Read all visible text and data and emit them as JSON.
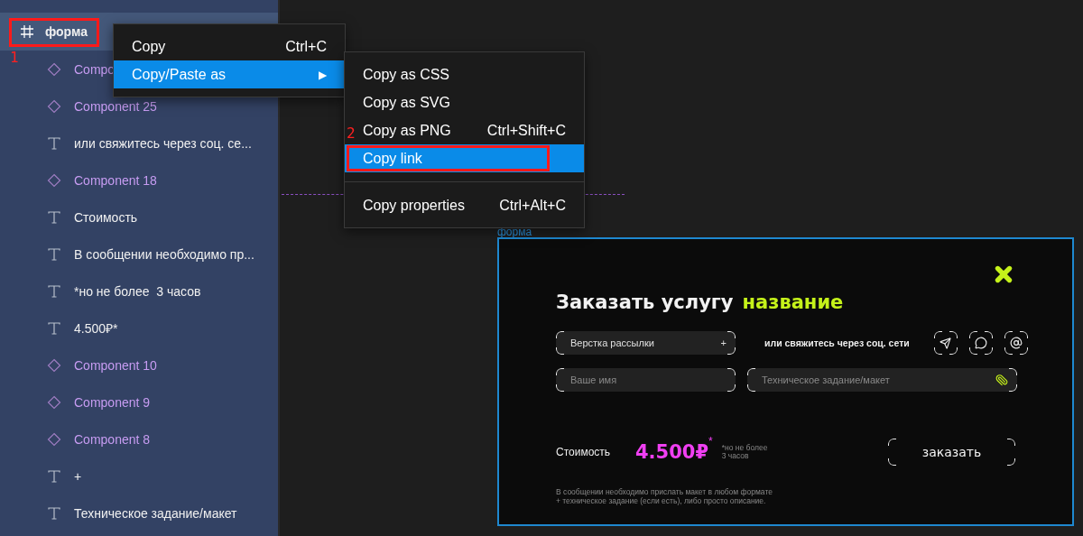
{
  "layers": {
    "header": {
      "label": "форма",
      "selected": true,
      "annotation": "1"
    },
    "items": [
      {
        "kind": "component",
        "label": "Compo"
      },
      {
        "kind": "component",
        "label": "Component 25"
      },
      {
        "kind": "text",
        "label": "или свяжитесь через соц. се..."
      },
      {
        "kind": "component",
        "label": "Component 18"
      },
      {
        "kind": "text",
        "label": "Стоимость"
      },
      {
        "kind": "text",
        "label": "В сообщении необходимо пр..."
      },
      {
        "kind": "text",
        "label": "*но не более  3 часов"
      },
      {
        "kind": "text",
        "label": "4.500₽*"
      },
      {
        "kind": "component",
        "label": "Component 10"
      },
      {
        "kind": "component",
        "label": "Component 9"
      },
      {
        "kind": "component",
        "label": "Component 8"
      },
      {
        "kind": "text",
        "label": "+"
      },
      {
        "kind": "text",
        "label": "Техническое задание/макет"
      }
    ]
  },
  "context_menu": {
    "items": [
      {
        "kind": "item",
        "label": "Copy",
        "shortcut": "Ctrl+C",
        "selected": false
      },
      {
        "kind": "submenu",
        "label": "Copy/Paste as",
        "arrow": "▶",
        "selected": true
      }
    ]
  },
  "submenu": {
    "items": [
      {
        "kind": "item",
        "label": "Copy as CSS",
        "selected": false
      },
      {
        "kind": "item",
        "label": "Copy as SVG",
        "selected": false
      },
      {
        "kind": "item",
        "label": "Copy as PNG",
        "shortcut": "Ctrl+Shift+C",
        "selected": false
      },
      {
        "kind": "item",
        "label": "Copy link",
        "selected": true,
        "annotation": "2"
      },
      {
        "kind": "separator"
      },
      {
        "kind": "item",
        "label": "Copy properties",
        "shortcut": "Ctrl+Alt+C",
        "selected": false
      }
    ]
  },
  "canvas": {
    "frame_label": "форма",
    "modal": {
      "title": "Заказать услугу",
      "title_accent": "название",
      "service_select": {
        "value": "Верстка рассылки",
        "plus": "+"
      },
      "contact_text": "или свяжитесь через соц. сети",
      "contact_buttons": [
        {
          "kind": "telegram"
        },
        {
          "kind": "whatsapp"
        },
        {
          "kind": "email"
        }
      ],
      "name_field": {
        "placeholder": "Ваше имя"
      },
      "brief_field": {
        "placeholder": "Техническое задание/макет"
      },
      "price_label": "Стоимость",
      "price": "4.500₽",
      "price_mark": "*",
      "price_note": [
        "*но не более",
        "3 часов"
      ],
      "submit": "заказать",
      "footnote": [
        "В сообщении необходимо прислать макет в любом формате",
        "+ техническое задание (если есть), либо просто описание."
      ]
    }
  }
}
